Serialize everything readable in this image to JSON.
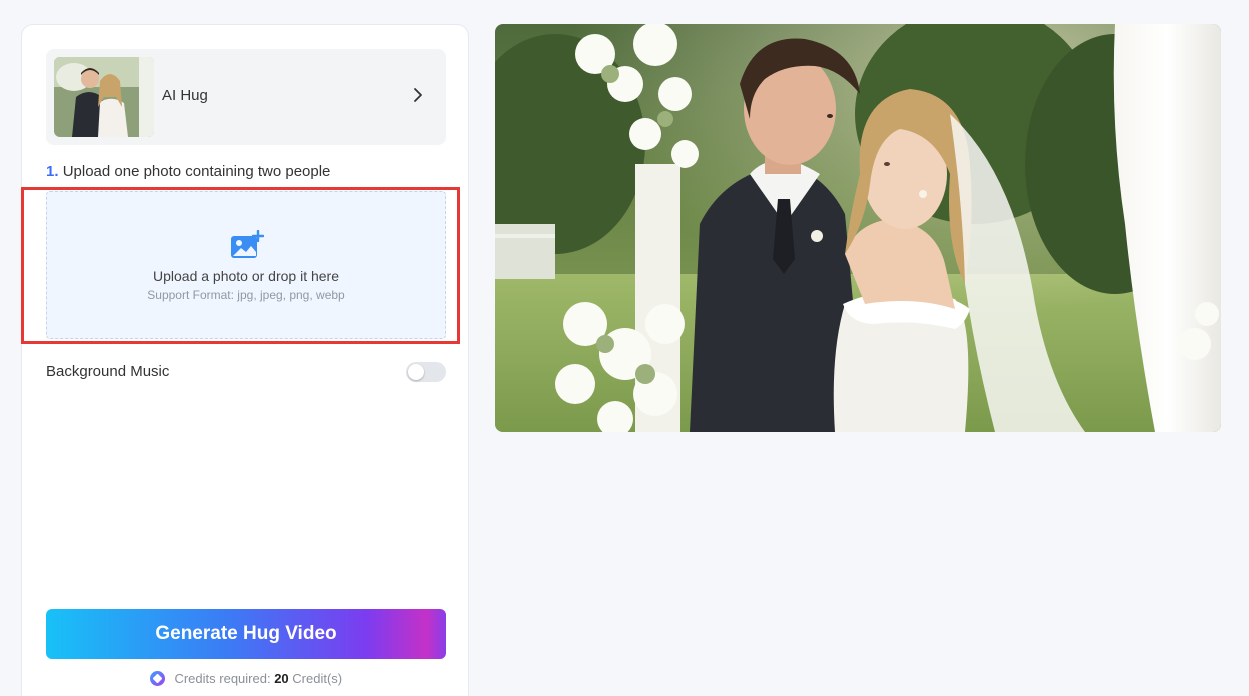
{
  "model": {
    "name": "AI Hug"
  },
  "upload": {
    "step_number": "1.",
    "step_label": "Upload one photo containing two people",
    "title": "Upload a photo or drop it here",
    "formats": "Support Format: jpg, jpeg, png, webp"
  },
  "settings": {
    "background_music_label": "Background Music",
    "background_music_enabled": false
  },
  "actions": {
    "generate_label": "Generate Hug Video"
  },
  "credits": {
    "prefix": "Credits required:",
    "value": "20",
    "suffix": "Credit(s)"
  },
  "icons": {
    "upload": "image-add-icon",
    "chevron": "chevron-right-icon",
    "credit": "credit-gem-icon"
  },
  "colors": {
    "accent": "#3b6cf6",
    "highlight": "#e53935",
    "upload_bg": "#f0f6ff"
  }
}
